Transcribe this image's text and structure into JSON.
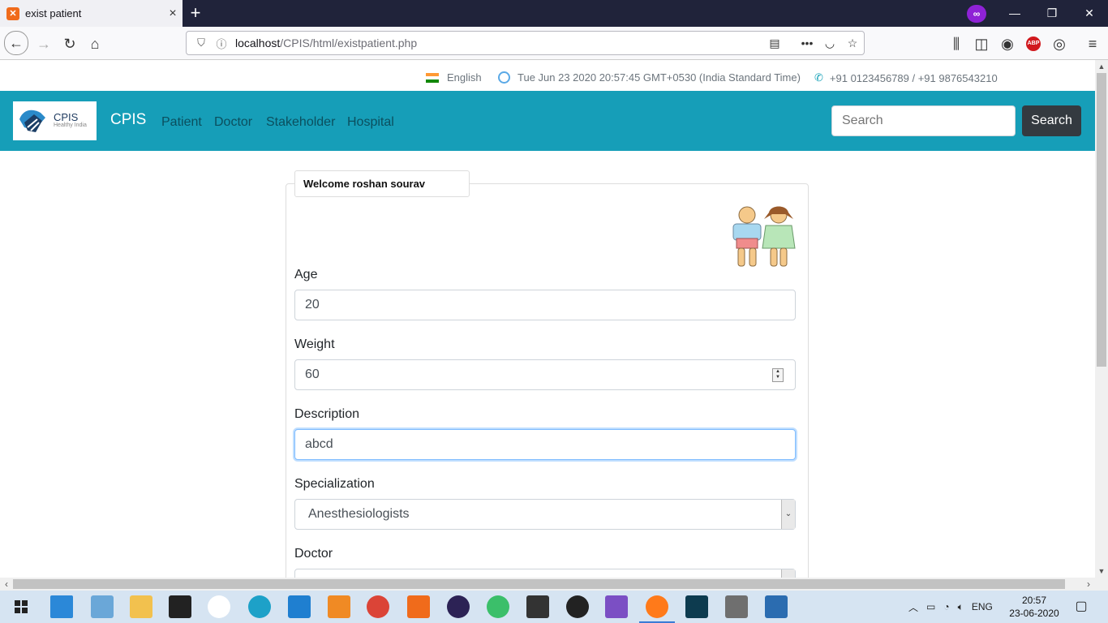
{
  "browser": {
    "tab_title": "exist patient",
    "url_host": "localhost",
    "url_path": "/CPIS/html/existpatient.php",
    "new_tab_glyph": "+",
    "private_badge": "∞"
  },
  "info_strip": {
    "language": "English",
    "datetime": "Tue Jun 23 2020 20:57:45 GMT+0530 (India Standard Time)",
    "phones": "+91 0123456789 / +91 9876543210"
  },
  "site_nav": {
    "logo_title": "CPIS",
    "logo_subtitle": "Healthy India",
    "brand": "CPIS",
    "links": [
      "Patient",
      "Doctor",
      "Stakeholder",
      "Hospital"
    ],
    "search_placeholder": "Search",
    "search_button": "Search"
  },
  "form": {
    "welcome": "Welcome roshan sourav",
    "age_label": "Age",
    "age_value": "20",
    "weight_label": "Weight",
    "weight_value": "60",
    "description_label": "Description",
    "description_value": "abcd",
    "specialization_label": "Specialization",
    "specialization_value": "Anesthesiologists",
    "doctor_label": "Doctor"
  },
  "taskbar": {
    "time": "20:57",
    "date": "23-06-2020",
    "lang": "ENG"
  },
  "colors": {
    "site_nav_bg": "#169eb8",
    "tabbar_bg": "#20233a",
    "search_btn_bg": "#343a40"
  }
}
